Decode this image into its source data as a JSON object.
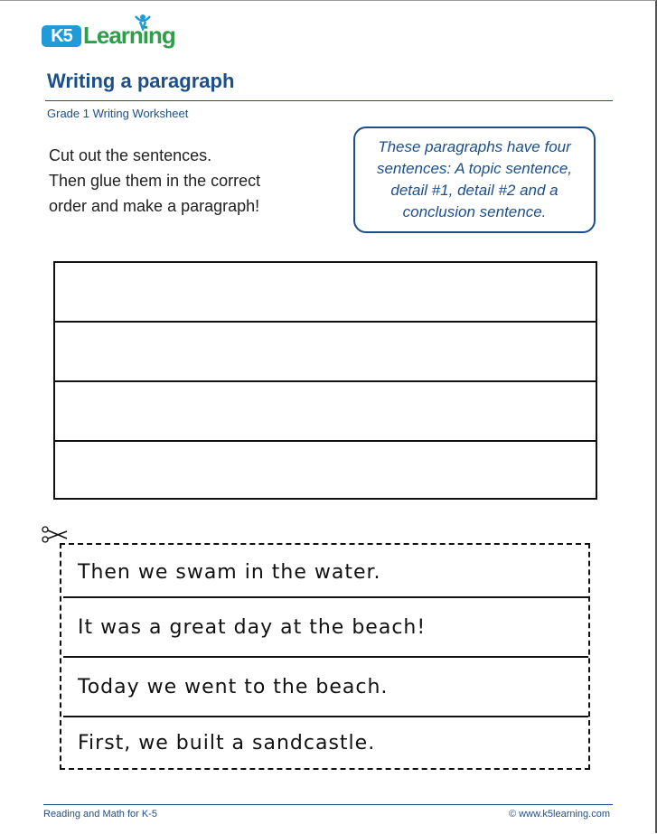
{
  "logo": {
    "badge_text": "K5",
    "word_text": "Learning"
  },
  "header": {
    "title": "Writing a paragraph",
    "subtitle": "Grade 1 Writing Worksheet"
  },
  "instructions": [
    "Cut out the sentences.",
    "Then glue them in the correct",
    "order and make a paragraph!"
  ],
  "note": "These paragraphs have four sentences: A topic sentence, detail #1, detail #2 and a conclusion sentence.",
  "answer_rows": 4,
  "cutout_sentences": [
    "Then we swam in the water.",
    "It was a great day at the beach!",
    "Today we went to the beach.",
    "First, we built a sandcastle."
  ],
  "footer": {
    "left": "Reading and Math for K-5",
    "right": "© www.k5learning.com"
  },
  "colors": {
    "brand_blue": "#1b4f8c",
    "logo_blue": "#1f9bd7",
    "logo_green": "#2f9e4a"
  },
  "icons": [
    "scissors-icon",
    "k5-logo-figure-icon"
  ]
}
